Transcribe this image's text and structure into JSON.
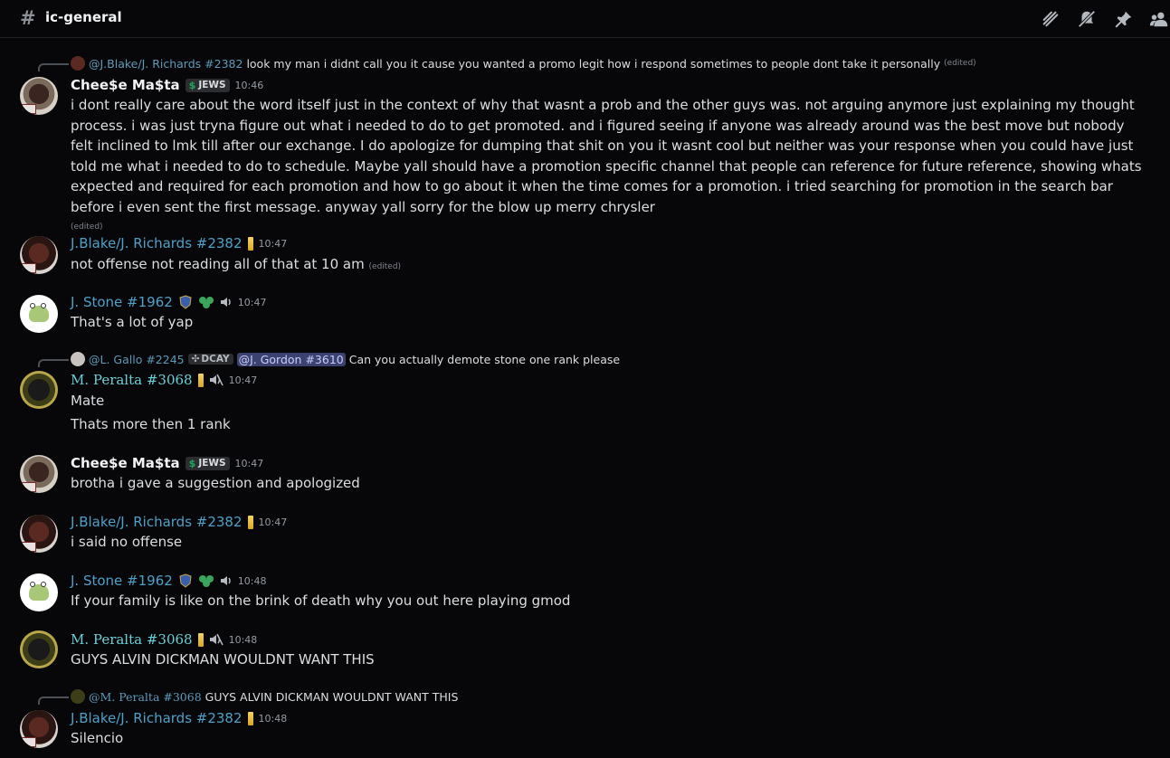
{
  "header": {
    "channel_name": "ic-general",
    "hash_icon": "hash-icon",
    "icons": [
      "threads-icon",
      "mute-icon",
      "pin-icon",
      "members-icon"
    ]
  },
  "messages": [
    {
      "reply": {
        "name": "@J.Blake/J. Richards #2382",
        "text": "look my man i didnt call you it cause you wanted a promo legit how i respond sometimes to people dont take it personally",
        "edited": "(edited)"
      },
      "author": "Chee$e Ma$ta",
      "tag": "JEWS",
      "time": "10:46",
      "text": "i dont really care about the word itself just in the context of why that wasnt a prob and the other guys was. not arguing anymore just explaining my thought process. i was just tryna figure out what i needed to do to get promoted. and i figured seeing if anyone was already around was the best move but nobody felt inclined to lmk till after our exchange. I do apologize for dumping that shit on you it wasnt cool but neither was your response when you could have just told me what i needed to do to schedule. Maybe yall should have a promotion specific channel that people can reference for future reference, showing whats expected and required for each promotion and how to go about it when the time comes for a promotion. i tried searching for  promotion in the search bar before i even sent the first message. anyway yall sorry for the blow up merry chrysler",
      "edited": "(edited)"
    },
    {
      "author": "J.Blake/J. Richards #2382",
      "time": "10:47",
      "text": "not offense not reading all of that at 10 am",
      "edited": "(edited)"
    },
    {
      "author": "J. Stone #1962",
      "time": "10:47",
      "text": "That's a lot of yap"
    },
    {
      "reply": {
        "name": "@L. Gallo #2245",
        "tag": "DCAY",
        "mention": "@J. Gordon #3610",
        "text": "Can you actually demote stone one rank please"
      },
      "author": "M. Peralta #3068",
      "time": "10:47",
      "text": "Mate",
      "text2": "Thats more then 1 rank"
    },
    {
      "author": "Chee$e Ma$ta",
      "tag": "JEWS",
      "time": "10:47",
      "text": "brotha i gave a suggestion and apologized"
    },
    {
      "author": "J.Blake/J. Richards #2382",
      "time": "10:47",
      "text": "i said no offense"
    },
    {
      "author": "J. Stone #1962",
      "time": "10:48",
      "text": "If your family is like on the brink of death why you out here playing gmod"
    },
    {
      "author": "M. Peralta #3068",
      "time": "10:48",
      "text": "GUYS ALVIN DICKMAN WOULDNT WANT THIS"
    },
    {
      "reply": {
        "name": "@M. Peralta #3068",
        "text": "GUYS ALVIN DICKMAN WOULDNT WANT THIS"
      },
      "author": "J.Blake/J. Richards #2382",
      "time": "10:48",
      "text": "Silencio"
    }
  ]
}
